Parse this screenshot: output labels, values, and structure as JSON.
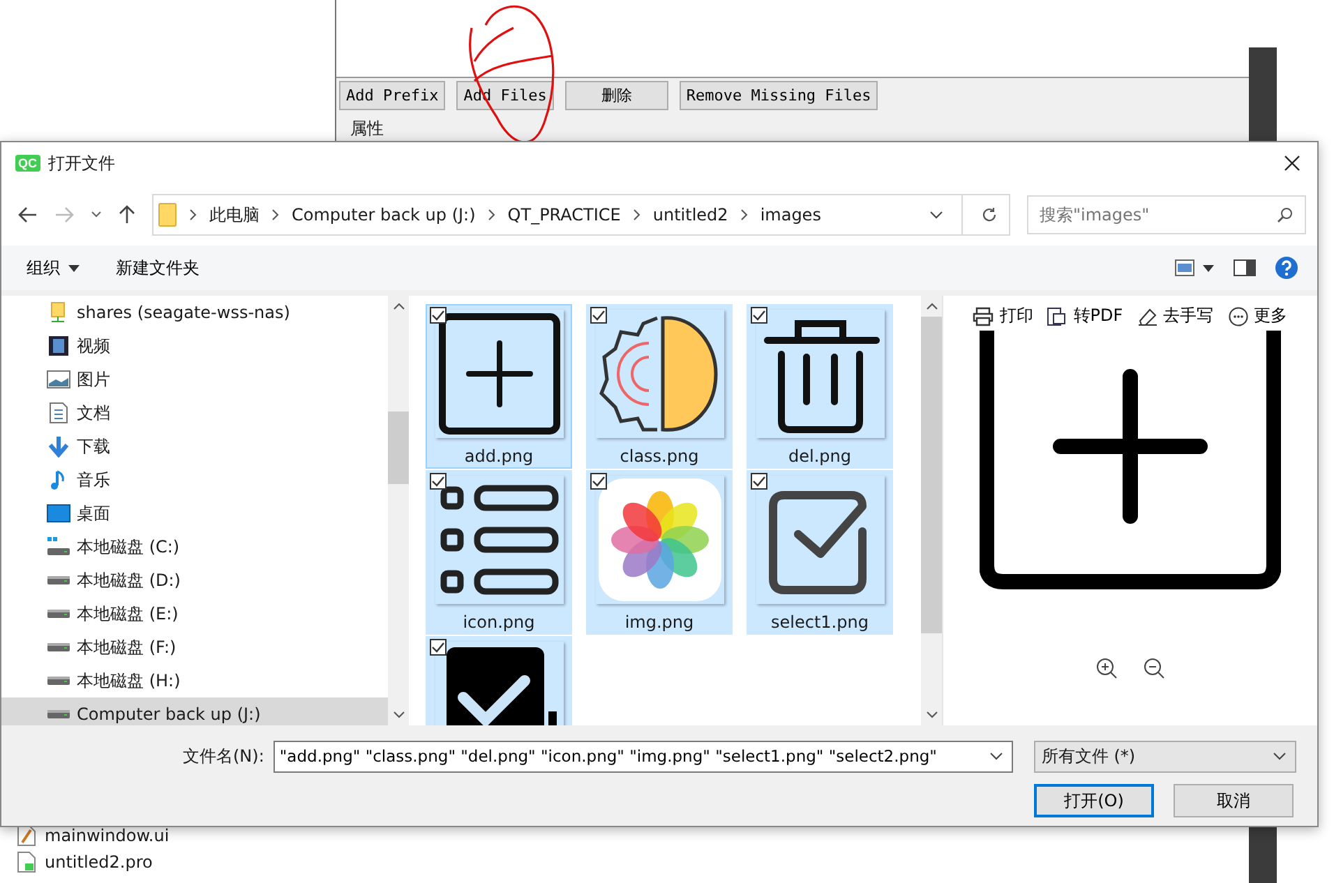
{
  "background_app": {
    "buttons": [
      "Add Prefix",
      "Add Files",
      "删除",
      "Remove Missing Files"
    ],
    "group_label": "属性",
    "files": [
      {
        "name": "mainwindow.ui",
        "kind": "ui"
      },
      {
        "name": "untitled2.pro",
        "kind": "pro"
      }
    ]
  },
  "dialog": {
    "app_logo": "QC",
    "title": "打开文件",
    "breadcrumb": [
      "此电脑",
      "Computer back up (J:)",
      "QT_PRACTICE",
      "untitled2",
      "images"
    ],
    "search": {
      "placeholder": "搜索\"images\""
    },
    "toolbar": [
      {
        "label": "组织",
        "kind": "menu"
      },
      {
        "label": "新建文件夹",
        "kind": "plain"
      }
    ],
    "nav_items": [
      {
        "label": "shares (seagate-wss-nas)",
        "kind": "network",
        "selected": false
      },
      {
        "label": "视频",
        "kind": "videos",
        "selected": false
      },
      {
        "label": "图片",
        "kind": "pictures",
        "selected": false
      },
      {
        "label": "文档",
        "kind": "documents",
        "selected": false
      },
      {
        "label": "下载",
        "kind": "downloads",
        "selected": false
      },
      {
        "label": "音乐",
        "kind": "music",
        "selected": false
      },
      {
        "label": "桌面",
        "kind": "desktop",
        "selected": false
      },
      {
        "label": "本地磁盘 (C:)",
        "kind": "system-drive",
        "selected": false
      },
      {
        "label": "本地磁盘 (D:)",
        "kind": "drive",
        "selected": false
      },
      {
        "label": "本地磁盘 (E:)",
        "kind": "drive",
        "selected": false
      },
      {
        "label": "本地磁盘 (F:)",
        "kind": "drive",
        "selected": false
      },
      {
        "label": "本地磁盘 (H:)",
        "kind": "drive",
        "selected": false
      },
      {
        "label": "Computer back up (J:)",
        "kind": "drive",
        "selected": true
      }
    ],
    "files": [
      {
        "name": "add.png",
        "kind": "plus-box",
        "selected": true,
        "checked": true
      },
      {
        "name": "class.png",
        "kind": "gear-brain",
        "selected": true,
        "checked": true
      },
      {
        "name": "del.png",
        "kind": "trash",
        "selected": true,
        "checked": true
      },
      {
        "name": "icon.png",
        "kind": "list",
        "selected": true,
        "checked": true
      },
      {
        "name": "img.png",
        "kind": "flower",
        "selected": true,
        "checked": true
      },
      {
        "name": "select1.png",
        "kind": "check-outline",
        "selected": true,
        "checked": true
      },
      {
        "kind": "check-filled",
        "selected": true,
        "checked": true
      }
    ],
    "preview_toolbar": [
      {
        "label": "打印",
        "kind": "print"
      },
      {
        "label": "转PDF",
        "kind": "pdf"
      },
      {
        "label": "去手写",
        "kind": "eraser"
      },
      {
        "label": "更多",
        "kind": "more"
      }
    ],
    "filename_label": "文件名(N):",
    "filename_value": "\"add.png\" \"class.png\" \"del.png\" \"icon.png\" \"img.png\" \"select1.png\" \"select2.png\"",
    "filetype": "所有文件 (*)",
    "buttons": [
      {
        "label": "打开(O)",
        "default": true
      },
      {
        "label": "取消",
        "default": false
      }
    ]
  }
}
